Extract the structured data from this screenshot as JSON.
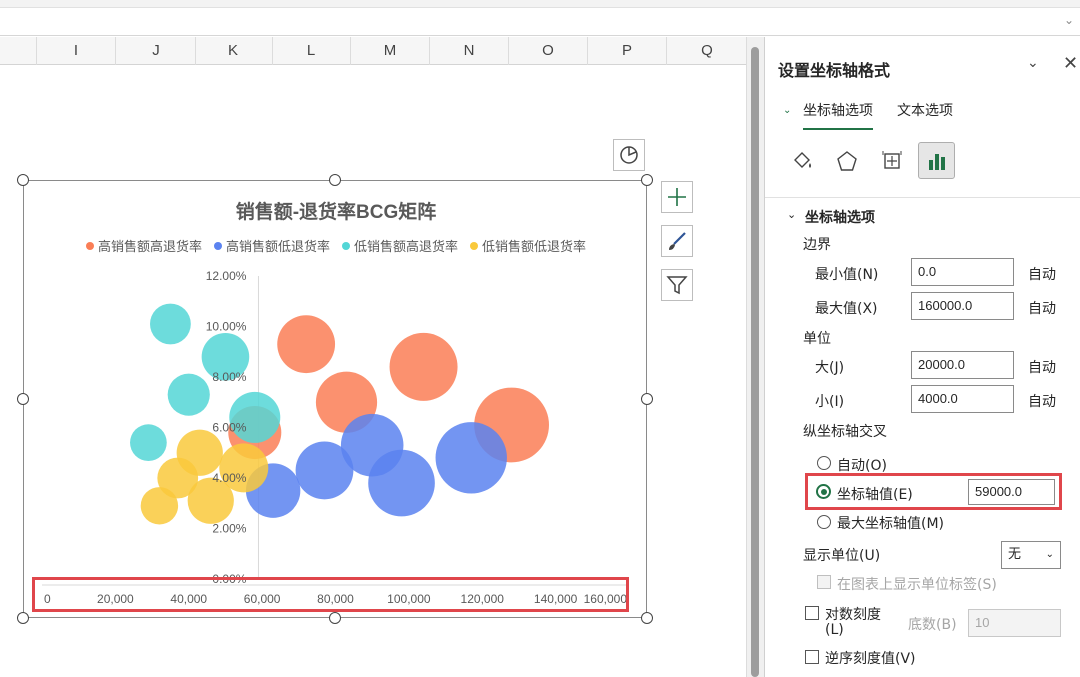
{
  "columns": [
    "I",
    "J",
    "K",
    "L",
    "M",
    "N",
    "O",
    "P",
    "Q"
  ],
  "chart": {
    "title": "销售额-退货率BCG矩阵",
    "legend": [
      {
        "label": "高销售额高退货率",
        "color": "#fa7e56"
      },
      {
        "label": "高销售额低退货率",
        "color": "#5b83f0"
      },
      {
        "label": "低销售额高退货率",
        "color": "#53d6d6"
      },
      {
        "label": "低销售额低退货率",
        "color": "#f9c93c"
      }
    ]
  },
  "chart_data": {
    "type": "scatter",
    "subtype": "bubble",
    "title": "销售额-退货率BCG矩阵",
    "xlim": [
      0,
      160000
    ],
    "ylim": [
      0,
      0.12
    ],
    "x_ticks": [
      "0",
      "20,000",
      "40,000",
      "60,000",
      "80,000",
      "100,000",
      "120,000",
      "140,000",
      "160,000"
    ],
    "y_ticks": [
      "0.00%",
      "2.00%",
      "4.00%",
      "6.00%",
      "8.00%",
      "10.00%",
      "12.00%"
    ],
    "vertical_axis_crosses_at": 59000,
    "series": [
      {
        "name": "高销售额高退货率",
        "color": "#fa7e56",
        "points": [
          {
            "x": 72000,
            "y": 0.093,
            "size": 0.85
          },
          {
            "x": 104000,
            "y": 0.084,
            "size": 1.0
          },
          {
            "x": 83000,
            "y": 0.07,
            "size": 0.9
          },
          {
            "x": 58000,
            "y": 0.058,
            "size": 0.78
          },
          {
            "x": 128000,
            "y": 0.061,
            "size": 1.1
          }
        ]
      },
      {
        "name": "高销售额低退货率",
        "color": "#5b83f0",
        "points": [
          {
            "x": 90000,
            "y": 0.053,
            "size": 0.92
          },
          {
            "x": 77000,
            "y": 0.043,
            "size": 0.85
          },
          {
            "x": 98000,
            "y": 0.038,
            "size": 0.98
          },
          {
            "x": 63000,
            "y": 0.035,
            "size": 0.8
          },
          {
            "x": 117000,
            "y": 0.048,
            "size": 1.05
          }
        ]
      },
      {
        "name": "低销售额高退货率",
        "color": "#53d6d6",
        "points": [
          {
            "x": 35000,
            "y": 0.101,
            "size": 0.6
          },
          {
            "x": 50000,
            "y": 0.088,
            "size": 0.7
          },
          {
            "x": 40000,
            "y": 0.073,
            "size": 0.62
          },
          {
            "x": 58000,
            "y": 0.064,
            "size": 0.75
          },
          {
            "x": 29000,
            "y": 0.054,
            "size": 0.54
          }
        ]
      },
      {
        "name": "低销售额低退货率",
        "color": "#f9c93c",
        "points": [
          {
            "x": 43000,
            "y": 0.05,
            "size": 0.68
          },
          {
            "x": 55000,
            "y": 0.044,
            "size": 0.72
          },
          {
            "x": 37000,
            "y": 0.04,
            "size": 0.6
          },
          {
            "x": 46000,
            "y": 0.031,
            "size": 0.68
          },
          {
            "x": 32000,
            "y": 0.029,
            "size": 0.55
          }
        ]
      }
    ]
  },
  "pane": {
    "title": "设置坐标轴格式",
    "tabs": [
      "坐标轴选项",
      "文本选项"
    ],
    "section": "坐标轴选项",
    "bounds_label": "边界",
    "min_label": "最小值(N)",
    "min_value": "0.0",
    "max_label": "最大值(X)",
    "max_value": "160000.0",
    "units_label": "单位",
    "major_label": "大(J)",
    "major_value": "20000.0",
    "minor_label": "小(I)",
    "minor_value": "4000.0",
    "auto": "自动",
    "cross_label": "纵坐标轴交叉",
    "cross_auto": "自动(O)",
    "cross_value_label": "坐标轴值(E)",
    "cross_value": "59000.0",
    "cross_max": "最大坐标轴值(M)",
    "display_units_label": "显示单位(U)",
    "display_units_value": "无",
    "show_units_label": "在图表上显示单位标签(S)",
    "log_label": "对数刻度",
    "log_label_2": "(L)",
    "base_label": "底数(B)",
    "base_value": "10",
    "reverse_label": "逆序刻度值(V)"
  }
}
